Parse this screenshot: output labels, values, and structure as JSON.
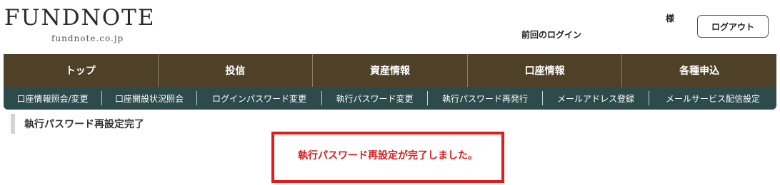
{
  "header": {
    "logo_title": "FUNDNOTE",
    "logo_subtitle": "fundnote.co.jp",
    "last_login_label": "前回のログイン",
    "honorific": "様",
    "logout_label": "ログアウト"
  },
  "main_nav": {
    "items": [
      {
        "label": "トップ"
      },
      {
        "label": "投信"
      },
      {
        "label": "資産情報"
      },
      {
        "label": "口座情報"
      },
      {
        "label": "各種申込"
      }
    ]
  },
  "sub_nav": {
    "items": [
      {
        "label": "口座情報照会/変更"
      },
      {
        "label": "口座開設状況照会"
      },
      {
        "label": "ログインパスワード変更"
      },
      {
        "label": "執行パスワード変更"
      },
      {
        "label": "執行パスワード再発行"
      },
      {
        "label": "メールアドレス登録"
      },
      {
        "label": "メールサービス配信設定"
      }
    ]
  },
  "main": {
    "page_title": "執行パスワード再設定完了",
    "message": "執行パスワード再設定が完了しました。"
  },
  "colors": {
    "main_nav_bg": "#4e4128",
    "sub_nav_bg": "#2d4b4b",
    "message_red": "#e41b1b"
  }
}
